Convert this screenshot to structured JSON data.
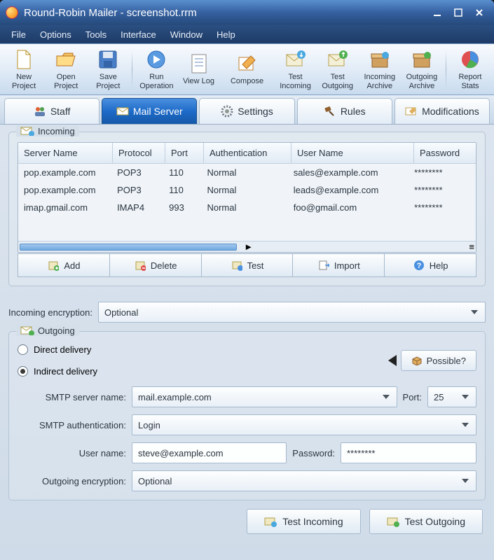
{
  "window": {
    "title": "Round-Robin Mailer - screenshot.rrm"
  },
  "menu": {
    "items": [
      "File",
      "Options",
      "Tools",
      "Interface",
      "Window",
      "Help"
    ]
  },
  "toolbar": {
    "items": [
      {
        "label": "New Project",
        "icon": "file-new-icon"
      },
      {
        "label": "Open Project",
        "icon": "folder-open-icon"
      },
      {
        "label": "Save Project",
        "icon": "disk-icon"
      },
      {
        "label": "Run Operation",
        "icon": "run-icon"
      },
      {
        "label": "View Log",
        "icon": "log-icon"
      },
      {
        "label": "Compose",
        "icon": "compose-icon"
      },
      {
        "label": "Test Incoming",
        "icon": "test-in-icon"
      },
      {
        "label": "Test Outgoing",
        "icon": "test-out-icon"
      },
      {
        "label": "Incoming Archive",
        "icon": "archive-in-icon"
      },
      {
        "label": "Outgoing Archive",
        "icon": "archive-out-icon"
      },
      {
        "label": "Report Stats",
        "icon": "piechart-icon"
      }
    ]
  },
  "tabs": {
    "items": [
      {
        "label": "Staff",
        "icon": "staff-icon"
      },
      {
        "label": "Mail Server",
        "icon": "mail-server-icon"
      },
      {
        "label": "Settings",
        "icon": "gear-icon"
      },
      {
        "label": "Rules",
        "icon": "gavel-icon"
      },
      {
        "label": "Modifications",
        "icon": "edit-icon"
      }
    ],
    "active_index": 1
  },
  "incoming": {
    "title": "Incoming",
    "columns": [
      "Server Name",
      "Protocol",
      "Port",
      "Authentication",
      "User Name",
      "Password"
    ],
    "rows": [
      {
        "server": "pop.example.com",
        "proto": "POP3",
        "port": "110",
        "auth": "Normal",
        "user": "sales@example.com",
        "pass": "********"
      },
      {
        "server": "pop.example.com",
        "proto": "POP3",
        "port": "110",
        "auth": "Normal",
        "user": "leads@example.com",
        "pass": "********"
      },
      {
        "server": "imap.gmail.com",
        "proto": "IMAP4",
        "port": "993",
        "auth": "Normal",
        "user": "foo@gmail.com",
        "pass": "********"
      }
    ],
    "buttons": {
      "add": "Add",
      "delete": "Delete",
      "test": "Test",
      "import": "Import",
      "help": "Help"
    },
    "encryption_label": "Incoming encryption:",
    "encryption_value": "Optional"
  },
  "outgoing": {
    "title": "Outgoing",
    "direct_label": "Direct delivery",
    "indirect_label": "Indirect delivery",
    "delivery_selected": "indirect",
    "possible_label": "Possible?",
    "smtp_server_label": "SMTP server name:",
    "smtp_server_value": "mail.example.com",
    "port_label": "Port:",
    "port_value": "25",
    "smtp_auth_label": "SMTP authentication:",
    "smtp_auth_value": "Login",
    "user_label": "User name:",
    "user_value": "steve@example.com",
    "password_label": "Password:",
    "password_value": "********",
    "encryption_label": "Outgoing encryption:",
    "encryption_value": "Optional"
  },
  "bottom": {
    "test_in": "Test Incoming",
    "test_out": "Test Outgoing"
  }
}
